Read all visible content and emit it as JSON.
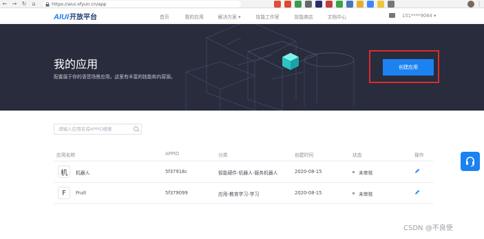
{
  "browser": {
    "url": "https://aiui.xfyun.cn/app",
    "ext_colors": [
      "#e44c3a",
      "#e0472f",
      "#3b9a4d",
      "#666666",
      "#2b2b6b",
      "#c43c36",
      "#3aa24a",
      "#4a73b8",
      "#e1b12c",
      "#4285f4",
      "#f0c53a",
      "#777777"
    ]
  },
  "header": {
    "logo_text": "AIUI",
    "logo_cn": "开放平台",
    "nav": [
      "首页",
      "我的应用",
      "解决方案 ▾",
      "技能工作室",
      "技能商店",
      "文档中心"
    ],
    "account": "151****9064 ▾"
  },
  "banner": {
    "title": "我的应用",
    "description": "配置属于你的语音场景应用，这里有丰富的技能和内容源。",
    "create_button": "创建应用"
  },
  "search": {
    "placeholder": "请输入应用名或APPID搜索"
  },
  "table": {
    "headers": [
      "应用名称",
      "APPID",
      "分类",
      "创建时间",
      "状态",
      "操作"
    ],
    "rows": [
      {
        "avatar": "机",
        "name": "机器人",
        "appid": "5f37918c",
        "category": "智能硬件-机器人-服务机器人",
        "created": "2020-08-15",
        "status": "未审核"
      },
      {
        "avatar": "F",
        "name": "Fruit",
        "appid": "5f379099",
        "category": "应用-教育学习-学习",
        "created": "2020-08-15",
        "status": "未审核"
      }
    ]
  },
  "watermark": "CSDN @不良使",
  "colors": {
    "accent": "#1c82f0",
    "banner_bg": "#282c3d",
    "highlight": "#e02b2b"
  }
}
